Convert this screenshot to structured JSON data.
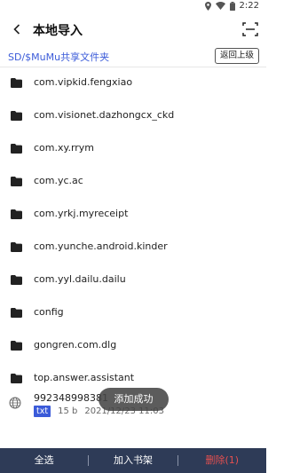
{
  "status_bar": {
    "time": "2:22"
  },
  "header": {
    "title": "本地导入"
  },
  "path": {
    "current": "SD/$MuMu共享文件夹",
    "parent_button": "返回上级"
  },
  "folders": [
    "com.vipkid.fengxiao",
    "com.visionet.dazhongcx_ckd",
    "com.xy.rrym",
    "com.yc.ac",
    "com.yrkj.myreceipt",
    "com.yunche.android.kinder",
    "com.yyl.dailu.dailu",
    "config",
    "gongren.com.dlg",
    "top.answer.assistant"
  ],
  "file": {
    "name": "992348998381",
    "type": "txt",
    "size": "15 b",
    "date": "2021/12/23 11:03"
  },
  "toast": "添加成功",
  "bottom_bar": {
    "select_all": "全选",
    "add_shelf": "加入书架",
    "delete": "删除(1)"
  },
  "colors": {
    "accent": "#3b5bd9",
    "bottom_bar": "#2e3b57",
    "delete": "#e65050"
  }
}
